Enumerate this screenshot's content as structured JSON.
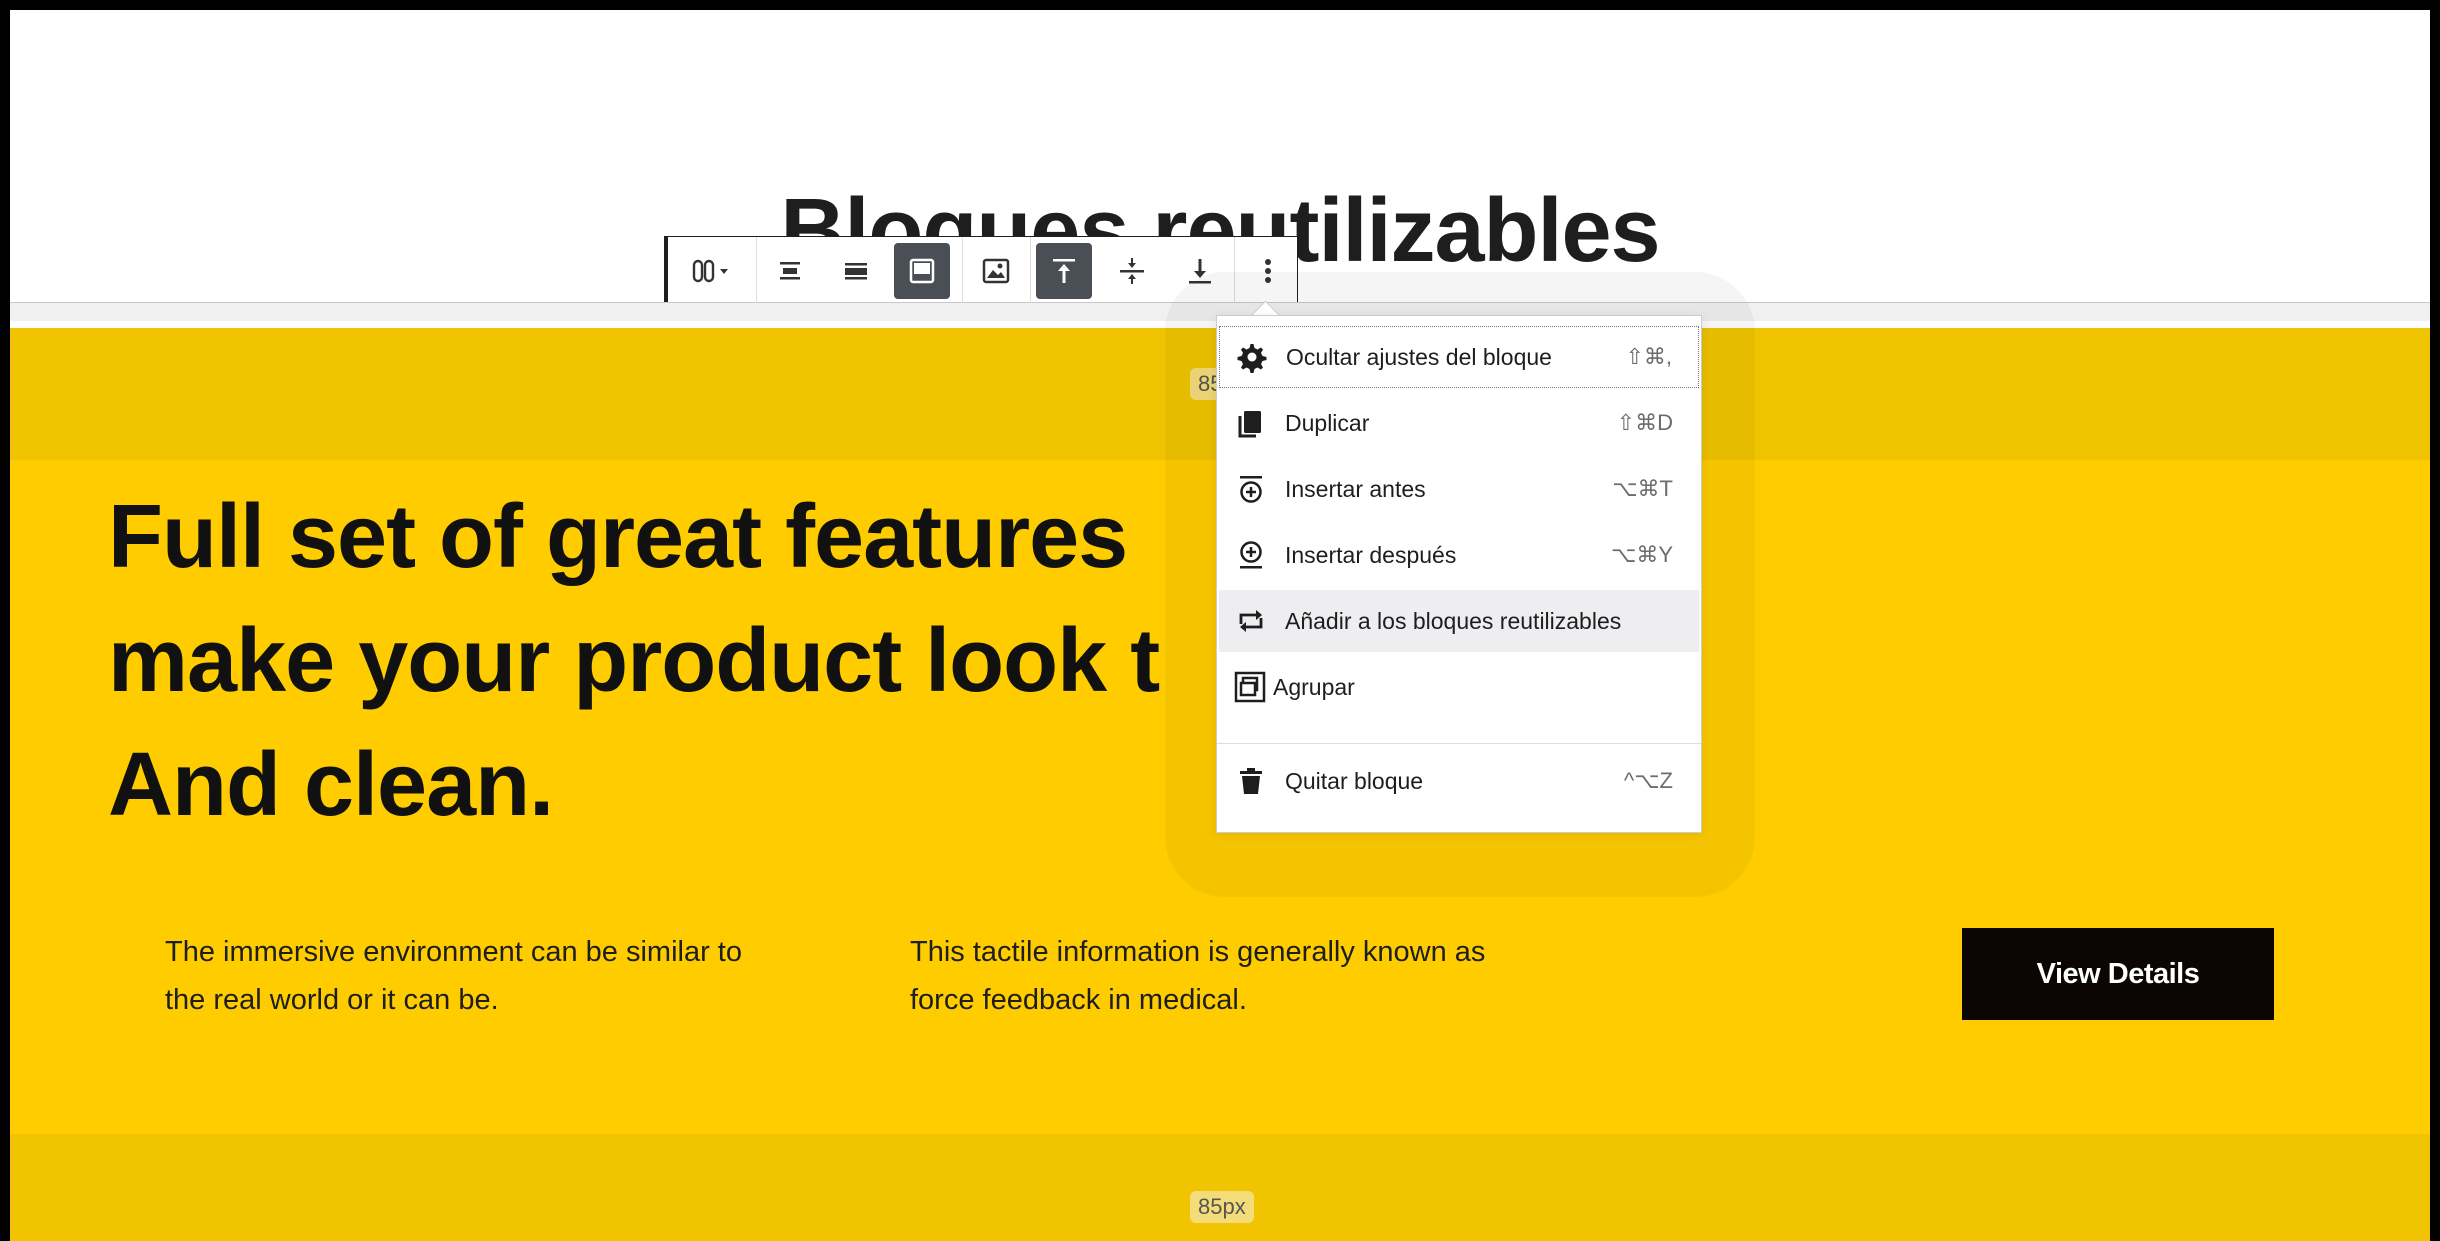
{
  "editor": {
    "post_title": "Bloques reutilizables"
  },
  "toolbar": {
    "buttons": [
      {
        "name": "columns-switcher",
        "icon": "columns-icon"
      },
      {
        "name": "align-wide",
        "icon": "align-wide-icon"
      },
      {
        "name": "align-full",
        "icon": "align-full-icon"
      },
      {
        "name": "align-content",
        "icon": "content-box-icon",
        "active": true
      },
      {
        "name": "background-image",
        "icon": "image-icon"
      },
      {
        "name": "vertical-align-top",
        "icon": "align-top-icon",
        "active": true
      },
      {
        "name": "vertical-align-center",
        "icon": "align-center-icon"
      },
      {
        "name": "vertical-align-bottom",
        "icon": "align-bottom-icon"
      },
      {
        "name": "more-options",
        "icon": "more-vertical-icon"
      }
    ]
  },
  "menu": {
    "items": [
      {
        "label": "Ocultar ajustes del bloque",
        "shortcut": "⇧⌘,",
        "icon": "gear-icon"
      },
      {
        "label": "Duplicar",
        "shortcut": "⇧⌘D",
        "icon": "duplicate-icon"
      },
      {
        "label": "Insertar antes",
        "shortcut": "⌥⌘T",
        "icon": "insert-before-icon"
      },
      {
        "label": "Insertar después",
        "shortcut": "⌥⌘Y",
        "icon": "insert-after-icon"
      },
      {
        "label": "Añadir a los bloques reutilizables",
        "shortcut": "",
        "icon": "reusable-icon"
      },
      {
        "label": "Agrupar",
        "shortcut": "",
        "icon": "group-icon"
      },
      {
        "label": "Quitar bloque",
        "shortcut": "^⌥Z",
        "icon": "trash-icon"
      }
    ]
  },
  "section": {
    "padding_top_label": "85px",
    "padding_bottom_label": "85px",
    "headline_lines": [
      "Full set of great features",
      "make your product look t",
      "And clean."
    ],
    "col1_text": "The immersive environment can be similar to the real world or it can be.",
    "col2_text": "This tactile information is generally known as force feedback in medical.",
    "button_label": "View Details"
  },
  "colors": {
    "section_bg": "#ffcc00",
    "padding_bg": "#f0c400",
    "button_bg": "#0b0603",
    "toolbar_active": "#4a4f55"
  }
}
